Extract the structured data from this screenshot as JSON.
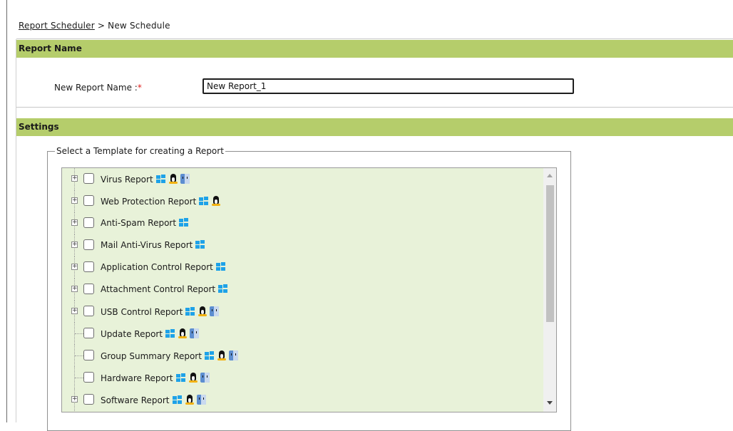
{
  "breadcrumb": {
    "link": "Report Scheduler",
    "separator": " > ",
    "current": "New Schedule"
  },
  "report_name_section": {
    "title": "Report Name",
    "label": "New Report Name :",
    "required_mark": "*",
    "input_value": "New Report_1"
  },
  "settings_section": {
    "title": "Settings",
    "template_legend": "Select a Template for creating a Report"
  },
  "templates": [
    {
      "label": "Virus Report",
      "expandable": true,
      "os": [
        "windows",
        "linux",
        "mac"
      ]
    },
    {
      "label": "Web Protection Report",
      "expandable": true,
      "os": [
        "windows",
        "linux"
      ]
    },
    {
      "label": "Anti-Spam Report",
      "expandable": true,
      "os": [
        "windows"
      ]
    },
    {
      "label": "Mail Anti-Virus Report",
      "expandable": true,
      "os": [
        "windows"
      ]
    },
    {
      "label": "Application Control Report",
      "expandable": true,
      "os": [
        "windows"
      ]
    },
    {
      "label": "Attachment Control Report",
      "expandable": true,
      "os": [
        "windows"
      ]
    },
    {
      "label": "USB Control Report",
      "expandable": true,
      "os": [
        "windows",
        "linux",
        "mac"
      ]
    },
    {
      "label": "Update Report",
      "expandable": false,
      "os": [
        "windows",
        "linux",
        "mac"
      ]
    },
    {
      "label": "Group Summary Report",
      "expandable": false,
      "os": [
        "windows",
        "linux",
        "mac"
      ]
    },
    {
      "label": "Hardware Report",
      "expandable": false,
      "os": [
        "windows",
        "linux",
        "mac"
      ]
    },
    {
      "label": "Software Report",
      "expandable": true,
      "os": [
        "windows",
        "linux",
        "mac"
      ]
    }
  ],
  "icons": {
    "expand": "plus-box-icon",
    "windows": "windows-logo-icon",
    "linux": "linux-tux-icon",
    "mac": "mac-finder-icon"
  },
  "colors": {
    "section_band": "#b5cd6b",
    "tree_background": "#e8f2d9",
    "required": "#e0211d"
  }
}
